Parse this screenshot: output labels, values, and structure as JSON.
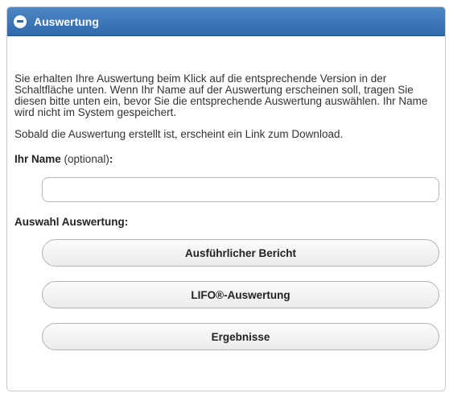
{
  "header": {
    "title": "Auswertung",
    "icon": "minus-circle-icon"
  },
  "body": {
    "intro": "Sie erhalten Ihre Auswertung beim Klick auf die entsprechende Version in der Schaltfläche unten. Wenn Ihr Name auf der Auswertung erscheinen soll, tragen Sie diesen bitte unten ein, bevor Sie die entsprechende Auswertung auswählen. Ihr Name wird nicht im System gespeichert.",
    "download_note": "Sobald die Auswertung erstellt ist, erscheint ein Link zum Download.",
    "name_label": "Ihr Name",
    "name_optional": "(optional)",
    "name_colon": ":",
    "name_value": "",
    "choice_label": "Auswahl Auswertung:"
  },
  "buttons": [
    {
      "label": "Ausführlicher Bericht"
    },
    {
      "label": "LIFO®-Auswertung"
    },
    {
      "label": "Ergebnisse"
    }
  ],
  "colors": {
    "header_blue": "#2f6aad",
    "text": "#333333"
  }
}
